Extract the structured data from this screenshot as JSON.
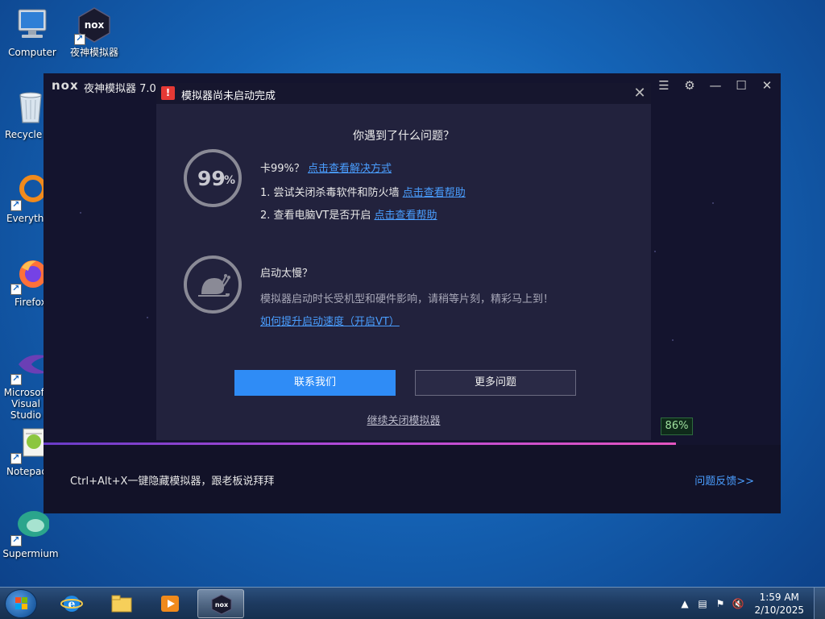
{
  "desktop": {
    "icons": [
      {
        "label": "Computer"
      },
      {
        "label": "夜神模拟器"
      },
      {
        "label": "Recycle Bin"
      },
      {
        "label": "Everything"
      },
      {
        "label": "Firefox"
      },
      {
        "label": "Microsoft Visual Studio"
      },
      {
        "label": "Notepad++"
      },
      {
        "label": "Supermium"
      }
    ]
  },
  "nox": {
    "logo": "nox",
    "title": "夜神模拟器 7.0",
    "progress_percent": "86%",
    "progress_value": 0.86,
    "hint": "Ctrl+Alt+X一键隐藏模拟器，跟老板说拜拜",
    "feedback": "问题反馈>>"
  },
  "dialog": {
    "title": "模拟器尚未启动完成",
    "question": "你遇到了什么问题？",
    "stuck": {
      "number": "99",
      "percent_sign": "%",
      "heading": "卡99%？",
      "heading_link": "点击查看解决方式",
      "step1": "1. 尝试关闭杀毒软件和防火墙",
      "step1_link": "点击查看帮助",
      "step2": "2. 查看电脑VT是否开启",
      "step2_link": "点击查看帮助"
    },
    "slow": {
      "heading": "启动太慢？",
      "description": "模拟器启动时长受机型和硬件影响，请稍等片刻，精彩马上到！",
      "link": "如何提升启动速度（开启VT）"
    },
    "contact_button": "联系我们",
    "more_button": "更多问题",
    "continue_close": "继续关闭模拟器"
  },
  "taskbar": {
    "time": "1:59 AM",
    "date": "2/10/2025"
  }
}
